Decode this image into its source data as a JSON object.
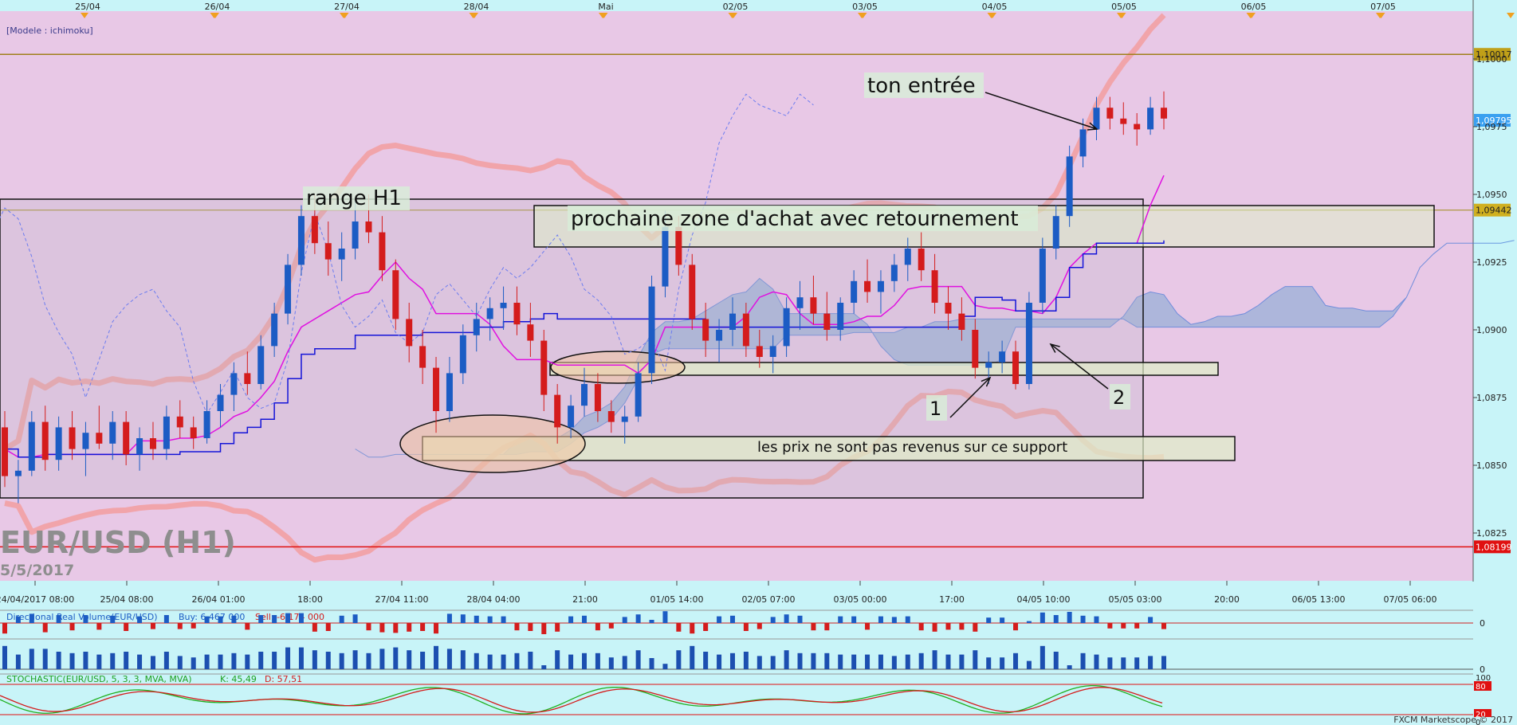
{
  "chart_data": {
    "type": "candlestick",
    "title": "EUR/USD (H1)",
    "subtitle": "5/5/2017",
    "model_label": "[Modele : ichimoku]",
    "watermark": "FXCM Marketscope © 2017",
    "top_dates": [
      "25/04",
      "26/04",
      "27/04",
      "28/04",
      "Mai",
      "02/05",
      "03/05",
      "04/05",
      "05/05",
      "06/05",
      "07/05"
    ],
    "x_ticks": [
      "24/04/2017 08:00",
      "25/04 08:00",
      "26/04 01:00",
      "18:00",
      "27/04 11:00",
      "28/04 04:00",
      "21:00",
      "01/05 14:00",
      "02/05 07:00",
      "03/05 00:00",
      "17:00",
      "04/05 10:00",
      "05/05 03:00",
      "20:00",
      "06/05 13:00",
      "07/05 06:00"
    ],
    "y_ticks": [
      "1,1000",
      "1,0975",
      "1,0950",
      "1,0925",
      "1,0900",
      "1,0875",
      "1,0850",
      "1,0825"
    ],
    "ylim": [
      1.0805,
      1.103
    ],
    "price_tags": {
      "upper_line": "1,10017",
      "current": "1,09795",
      "range_top": "1,09442",
      "lower_line": "1,08199"
    },
    "levels": {
      "upper_line": 1.10017,
      "range_top": 1.09442,
      "lower_line": 1.08199
    },
    "candles": [
      [
        1.0864,
        1.087,
        1.0842,
        1.0846
      ],
      [
        1.0846,
        1.0852,
        1.0836,
        1.0848
      ],
      [
        1.0848,
        1.087,
        1.0846,
        1.0866
      ],
      [
        1.0866,
        1.0872,
        1.0848,
        1.0852
      ],
      [
        1.0852,
        1.0868,
        1.0848,
        1.0864
      ],
      [
        1.0864,
        1.087,
        1.0852,
        1.0856
      ],
      [
        1.0856,
        1.0866,
        1.0846,
        1.0862
      ],
      [
        1.0862,
        1.0872,
        1.0856,
        1.0858
      ],
      [
        1.0858,
        1.087,
        1.0852,
        1.0866
      ],
      [
        1.0866,
        1.087,
        1.085,
        1.0854
      ],
      [
        1.0854,
        1.0864,
        1.0848,
        1.086
      ],
      [
        1.086,
        1.0866,
        1.0852,
        1.0856
      ],
      [
        1.0856,
        1.0872,
        1.0852,
        1.0868
      ],
      [
        1.0868,
        1.0874,
        1.086,
        1.0864
      ],
      [
        1.0864,
        1.0868,
        1.0856,
        1.086
      ],
      [
        1.086,
        1.0874,
        1.0858,
        1.087
      ],
      [
        1.087,
        1.088,
        1.0864,
        1.0876
      ],
      [
        1.0876,
        1.0888,
        1.087,
        1.0884
      ],
      [
        1.0884,
        1.0892,
        1.0876,
        1.088
      ],
      [
        1.088,
        1.0898,
        1.0878,
        1.0894
      ],
      [
        1.0894,
        1.091,
        1.089,
        1.0906
      ],
      [
        1.0906,
        1.0928,
        1.0902,
        1.0924
      ],
      [
        1.0924,
        1.0946,
        1.092,
        1.0942
      ],
      [
        1.0942,
        1.095,
        1.0928,
        1.0932
      ],
      [
        1.0932,
        1.094,
        1.092,
        1.0926
      ],
      [
        1.0926,
        1.0936,
        1.0918,
        1.093
      ],
      [
        1.093,
        1.0948,
        1.0926,
        1.094
      ],
      [
        1.094,
        1.095,
        1.0932,
        1.0936
      ],
      [
        1.0936,
        1.0942,
        1.0918,
        1.0922
      ],
      [
        1.0922,
        1.0926,
        1.09,
        1.0904
      ],
      [
        1.0904,
        1.091,
        1.0888,
        1.0894
      ],
      [
        1.0894,
        1.09,
        1.088,
        1.0886
      ],
      [
        1.0886,
        1.089,
        1.0862,
        1.087
      ],
      [
        1.087,
        1.089,
        1.0866,
        1.0884
      ],
      [
        1.0884,
        1.0902,
        1.088,
        1.0898
      ],
      [
        1.0898,
        1.091,
        1.0892,
        1.0904
      ],
      [
        1.0904,
        1.0912,
        1.0896,
        1.0908
      ],
      [
        1.0908,
        1.0916,
        1.09,
        1.091
      ],
      [
        1.091,
        1.0916,
        1.0898,
        1.0902
      ],
      [
        1.0902,
        1.091,
        1.089,
        1.0896
      ],
      [
        1.0896,
        1.09,
        1.087,
        1.0876
      ],
      [
        1.0876,
        1.088,
        1.0858,
        1.0864
      ],
      [
        1.0864,
        1.0876,
        1.086,
        1.0872
      ],
      [
        1.0872,
        1.0886,
        1.0868,
        1.088
      ],
      [
        1.088,
        1.0884,
        1.0866,
        1.087
      ],
      [
        1.087,
        1.0874,
        1.0862,
        1.0866
      ],
      [
        1.0866,
        1.0872,
        1.0858,
        1.0868
      ],
      [
        1.0868,
        1.0888,
        1.0866,
        1.0884
      ],
      [
        1.0884,
        1.092,
        1.088,
        1.0916
      ],
      [
        1.0916,
        1.0944,
        1.0912,
        1.0938
      ],
      [
        1.0938,
        1.0942,
        1.092,
        1.0924
      ],
      [
        1.0924,
        1.0928,
        1.09,
        1.0904
      ],
      [
        1.0904,
        1.091,
        1.089,
        1.0896
      ],
      [
        1.0896,
        1.0904,
        1.0888,
        1.09
      ],
      [
        1.09,
        1.0912,
        1.0894,
        1.0906
      ],
      [
        1.0906,
        1.091,
        1.089,
        1.0894
      ],
      [
        1.0894,
        1.09,
        1.0886,
        1.089
      ],
      [
        1.089,
        1.0898,
        1.0884,
        1.0894
      ],
      [
        1.0894,
        1.0912,
        1.089,
        1.0908
      ],
      [
        1.0908,
        1.0918,
        1.09,
        1.0912
      ],
      [
        1.0912,
        1.092,
        1.0902,
        1.0906
      ],
      [
        1.0906,
        1.0914,
        1.0896,
        1.09
      ],
      [
        1.09,
        1.0912,
        1.0896,
        1.091
      ],
      [
        1.091,
        1.0922,
        1.0906,
        1.0918
      ],
      [
        1.0918,
        1.0926,
        1.091,
        1.0914
      ],
      [
        1.0914,
        1.0922,
        1.0906,
        1.0918
      ],
      [
        1.0918,
        1.0928,
        1.0914,
        1.0924
      ],
      [
        1.0924,
        1.0934,
        1.0918,
        1.093
      ],
      [
        1.093,
        1.0936,
        1.0918,
        1.0922
      ],
      [
        1.0922,
        1.0928,
        1.0906,
        1.091
      ],
      [
        1.091,
        1.0916,
        1.09,
        1.0906
      ],
      [
        1.0906,
        1.0912,
        1.0896,
        1.09
      ],
      [
        1.09,
        1.0904,
        1.0882,
        1.0886
      ],
      [
        1.0886,
        1.0892,
        1.088,
        1.0888
      ],
      [
        1.0888,
        1.0896,
        1.0884,
        1.0892
      ],
      [
        1.0892,
        1.0896,
        1.0878,
        1.088
      ],
      [
        1.088,
        1.0914,
        1.0878,
        1.091
      ],
      [
        1.091,
        1.0934,
        1.0906,
        1.093
      ],
      [
        1.093,
        1.0946,
        1.0926,
        1.0942
      ],
      [
        1.0942,
        1.0968,
        1.0938,
        1.0964
      ],
      [
        1.0964,
        1.0978,
        1.096,
        1.0974
      ],
      [
        1.0974,
        1.0986,
        1.097,
        1.0982
      ],
      [
        1.0982,
        1.0986,
        1.0974,
        1.0978
      ],
      [
        1.0978,
        1.0984,
        1.0972,
        1.0976
      ],
      [
        1.0976,
        1.098,
        1.0968,
        1.0974
      ],
      [
        1.0974,
        1.0986,
        1.0972,
        1.0982
      ],
      [
        1.0982,
        1.0988,
        1.0974,
        1.0978
      ]
    ]
  },
  "annotations": {
    "range_h1": "range H1",
    "buy_zone": "prochaine zone d'achat avec retournement",
    "entry": "ton entrée",
    "support_note": "les prix ne sont pas revenus sur ce support",
    "marker_1": "1",
    "marker_2": "2"
  },
  "volume_panel": {
    "label": "Directional Real Volume(EUR/USD)",
    "buy": "Buy: 6 467 000",
    "sell": "Sell: -6 174 000",
    "zero": "0"
  },
  "volume_bars_panel": {
    "zero": "0"
  },
  "stochastic_panel": {
    "label": "STOCHASTIC(EUR/USD, 5, 3, 3, MVA, MVA)",
    "k": "K: 45,49",
    "d": "D: 57,51",
    "y_ticks": [
      "100",
      "80",
      "20",
      "0"
    ]
  },
  "colors": {
    "plot_bg": "#e8c8e6",
    "up": "#1c5cc4",
    "down": "#d41c1c",
    "kijun": "#1414d8",
    "tenkan": "#e010e0",
    "chikou": "#6b7cf0",
    "bollinger": "#f29b9b",
    "cloud_blue": "#9ab0d8",
    "cloud_red": "#f0b0b0"
  }
}
